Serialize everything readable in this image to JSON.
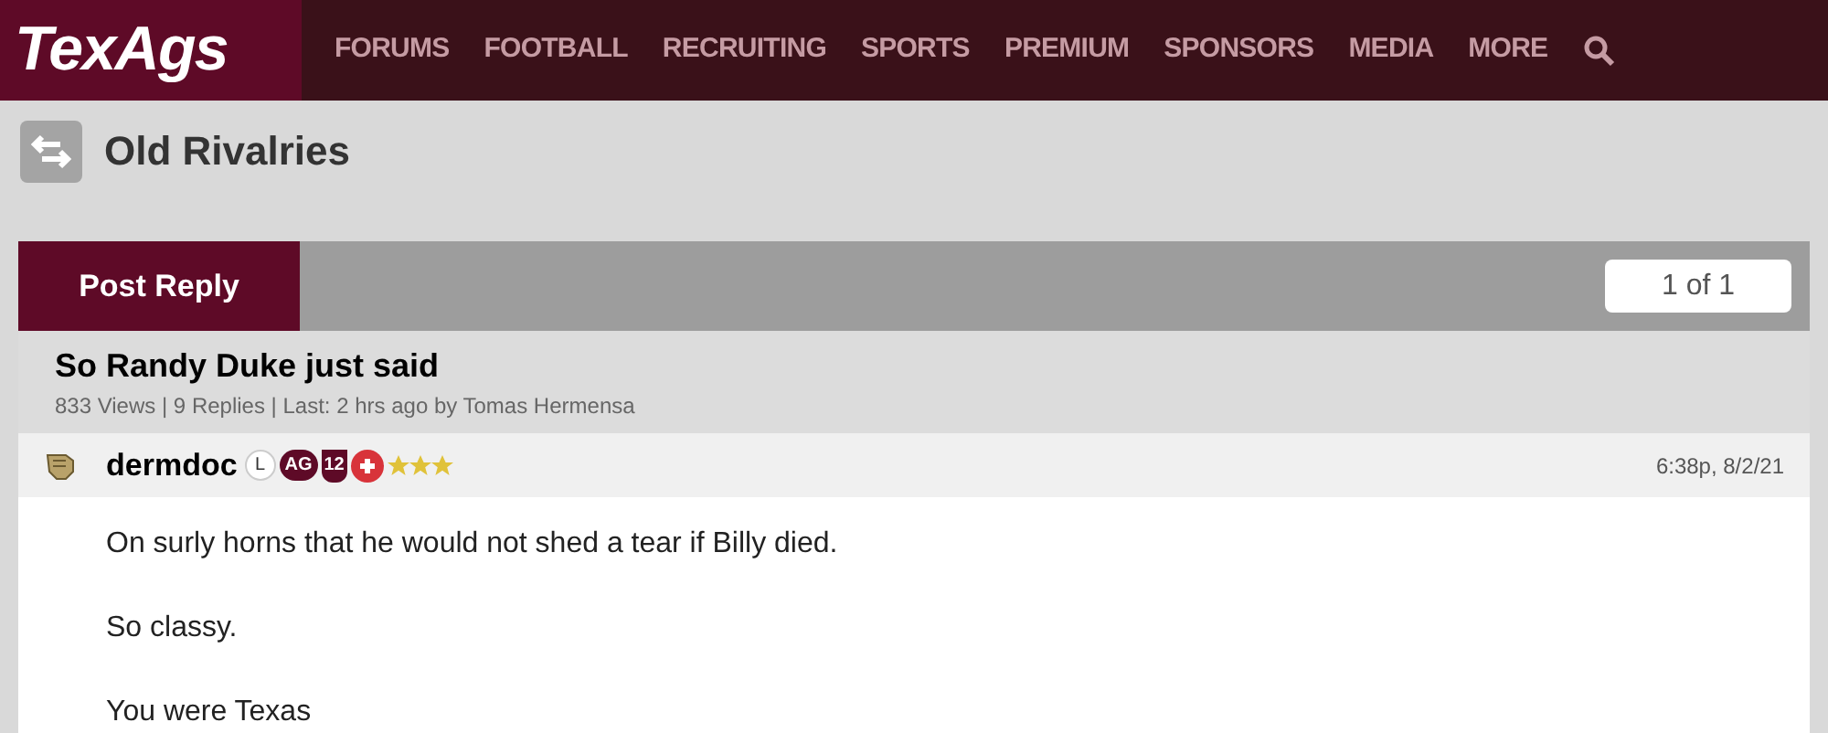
{
  "site": {
    "logo": "TexAgs"
  },
  "nav": [
    "FORUMS",
    "FOOTBALL",
    "RECRUITING",
    "SPORTS",
    "PREMIUM",
    "SPONSORS",
    "MEDIA",
    "MORE"
  ],
  "forum": {
    "title": "Old Rivalries"
  },
  "toolbar": {
    "post_reply": "Post Reply",
    "pagination": "1 of 1"
  },
  "thread": {
    "title": "So Randy Duke just said",
    "meta": "833 Views | 9 Replies | Last: 2 hrs ago by Tomas Hermensa"
  },
  "post": {
    "author": "dermdoc",
    "badges": [
      {
        "kind": "circle",
        "text": "L"
      },
      {
        "kind": "pill",
        "text": "AG"
      },
      {
        "kind": "shield",
        "text": "12"
      },
      {
        "kind": "cross"
      }
    ],
    "stars": 3,
    "time": "6:38p, 8/2/21",
    "paragraphs": [
      "On surly horns that he would not shed a tear if Billy died.",
      "So classy.",
      "You were Texas"
    ]
  }
}
